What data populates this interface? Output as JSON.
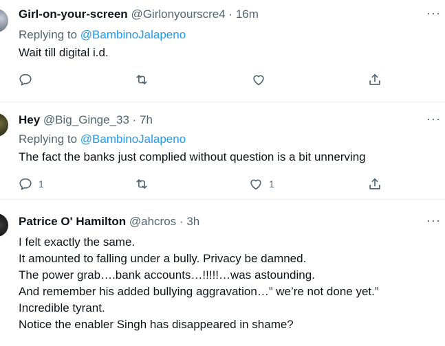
{
  "tweets": [
    {
      "name": "Girl-on-your-screen",
      "handle": "@Girlonyourscre4",
      "dot": "·",
      "time": "16m",
      "replying_prefix": "Replying to",
      "replying_to": "@BambinoJalapeno",
      "lines": [
        "Wait till digital i.d."
      ],
      "reply_count": "",
      "retweet_count": "",
      "like_count": ""
    },
    {
      "name": "Hey",
      "handle": "@Big_Ginge_33",
      "dot": "·",
      "time": "7h",
      "replying_prefix": "Replying to",
      "replying_to": "@BambinoJalapeno",
      "lines": [
        "The fact the banks just complied without question is a bit unnerving"
      ],
      "reply_count": "1",
      "retweet_count": "",
      "like_count": "1"
    },
    {
      "name": "Patrice O' Hamilton",
      "handle": "@ahcros",
      "dot": "·",
      "time": "3h",
      "lines": [
        "I felt exactly the same.",
        "It amounted to falling under a bully. Privacy be damned.",
        "The power grab….bank accounts…!!!!!…was astounding.",
        "And remember his added bullying aggravation…” we’re not done yet.”",
        "Incredible tyrant.",
        "Notice the enabler Singh has disappeared in shame?"
      ]
    }
  ],
  "more_glyph": "···"
}
